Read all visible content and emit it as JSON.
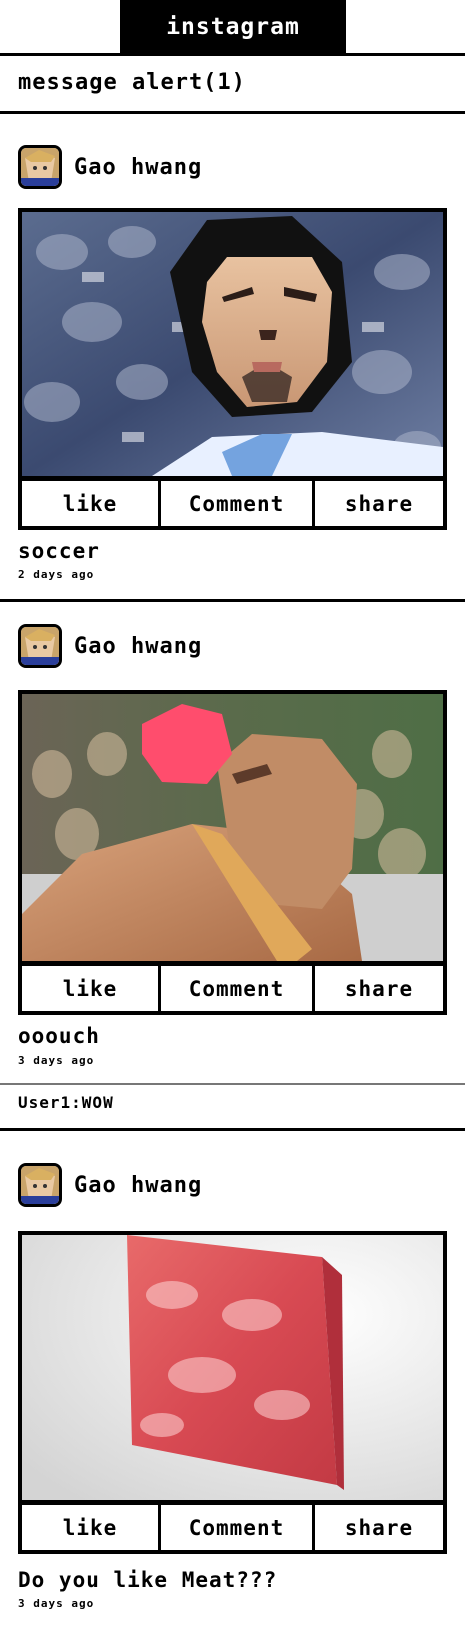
{
  "app": {
    "title": "instagram"
  },
  "alert": {
    "text": "message alert(1)"
  },
  "actions": {
    "like": "like",
    "comment": "Comment",
    "share": "share"
  },
  "posts": [
    {
      "author": "Gao hwang",
      "caption": "soccer",
      "time": "2 days ago",
      "image": "low-poly footballer portrait in blue and white striped shirt",
      "comments": []
    },
    {
      "author": "Gao hwang",
      "caption": "ooouch",
      "time": "3 days ago",
      "image": "low-poly boxer hit by a red-tipped baseball bat in front of a crowd",
      "comments": [
        {
          "text": "User1:WOW"
        }
      ]
    },
    {
      "author": "Gao hwang",
      "caption": "Do you like Meat???",
      "time": "3 days ago",
      "image": "block of marbled raw meat on white background",
      "comments": []
    }
  ],
  "colors": {
    "accent": "#000000",
    "background": "#ffffff"
  }
}
